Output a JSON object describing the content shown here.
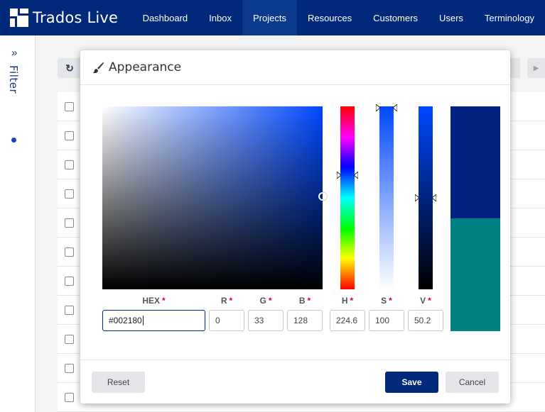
{
  "app": {
    "name": "Trados Live"
  },
  "nav": {
    "items": [
      {
        "label": "Dashboard",
        "active": false
      },
      {
        "label": "Inbox",
        "active": false
      },
      {
        "label": "Projects",
        "active": true
      },
      {
        "label": "Resources",
        "active": false
      },
      {
        "label": "Customers",
        "active": false
      },
      {
        "label": "Users",
        "active": false
      },
      {
        "label": "Terminology",
        "active": false
      }
    ]
  },
  "filter": {
    "label": "Filter",
    "chevron": "»"
  },
  "modal": {
    "title": "Appearance",
    "icon": "paintbrush-icon",
    "fields": {
      "hex": {
        "label": "HEX",
        "value": "#002180"
      },
      "r": {
        "label": "R",
        "value": "0"
      },
      "g": {
        "label": "G",
        "value": "33"
      },
      "b": {
        "label": "B",
        "value": "128"
      },
      "h": {
        "label": "H",
        "value": "224.6"
      },
      "s": {
        "label": "S",
        "value": "100"
      },
      "v": {
        "label": "V",
        "value": "50.2"
      }
    },
    "required_marker": "*",
    "preview": {
      "new_color": "#002180",
      "original_color": "#008080"
    },
    "buttons": {
      "reset": "Reset",
      "save": "Save",
      "cancel": "Cancel"
    }
  },
  "colors": {
    "brand": "#00297a",
    "accent": "#0048ff",
    "required": "#d0021b"
  }
}
